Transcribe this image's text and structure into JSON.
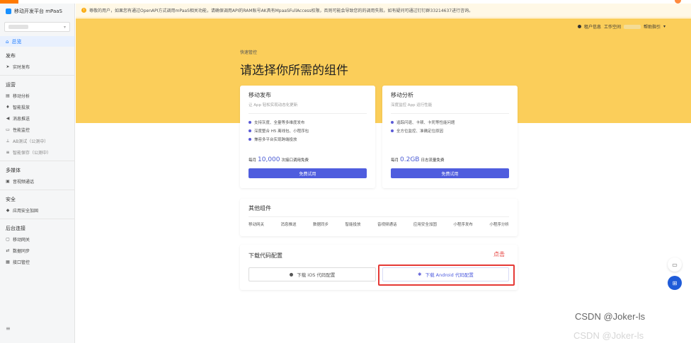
{
  "sidebar": {
    "brand": "移动开发平台 mPaaS",
    "home": "总览",
    "groups": [
      {
        "title": "发布",
        "items": [
          {
            "label": "实时发布",
            "icon": "send-icon"
          }
        ]
      },
      {
        "title": "运营",
        "items": [
          {
            "label": "移动分析",
            "icon": "chart-icon"
          },
          {
            "label": "智能投放",
            "icon": "pin-icon"
          },
          {
            "label": "消息推送",
            "icon": "megaphone-icon"
          },
          {
            "label": "性能监控",
            "icon": "monitor-icon"
          },
          {
            "label": "AB测试（公测中）",
            "icon": "ab-icon"
          },
          {
            "label": "智能保存（公测中）",
            "icon": "save-icon"
          }
        ]
      },
      {
        "title": "多媒体",
        "items": [
          {
            "label": "音视频通话",
            "icon": "video-icon"
          }
        ]
      },
      {
        "title": "安全",
        "items": [
          {
            "label": "应用安全加固",
            "icon": "shield-icon"
          }
        ]
      },
      {
        "title": "后台连接",
        "items": [
          {
            "label": "移动网关",
            "icon": "gateway-icon"
          },
          {
            "label": "数据同步",
            "icon": "sync-icon"
          },
          {
            "label": "接口管控",
            "icon": "api-icon"
          }
        ]
      }
    ]
  },
  "notice": {
    "text": "尊敬的用户，如果您有通过OpenAPI方式调用mPaaS相关功能，请确保调用API的RAM账号AK具有MpaaSFullAccess权限，否则可能会导致您的的调用失败。如有疑问可通过钉钉群33214637进行咨询。"
  },
  "header": {
    "tenant_info": "租户信息",
    "workspace": "工作空间",
    "help": "帮助指引"
  },
  "hero": {
    "breadcrumb": "快速管控",
    "title": "请选择你所需的组件"
  },
  "cards": {
    "publish": {
      "title": "移动发布",
      "subtitle": "让 App 轻松实现动态化更新",
      "features": [
        "支持灰度、全量等多维度发布",
        "深度整合 H5 离线包、小程序包",
        "兼容多平台实现跨端投放"
      ],
      "quota_prefix": "每月",
      "quota_value": "10,000",
      "quota_suffix": "次接口调用免费",
      "button": "免费试用"
    },
    "analytics": {
      "title": "移动分析",
      "subtitle": "深度监控 App 运行性能",
      "features": [
        "追踪闪退、卡顿、卡死等性能问题",
        "全方位监控、准确定位原因"
      ],
      "quota_prefix": "每月",
      "quota_value": "0.2GB",
      "quota_suffix": "日志流量免费",
      "button": "免费试用"
    }
  },
  "other": {
    "title": "其他组件",
    "items": [
      "移动网关",
      "消息推送",
      "数据同步",
      "智能投放",
      "音视频通话",
      "应用安全加固",
      "小程序发布",
      "小程序分析"
    ]
  },
  "download": {
    "title": "下载代码配置",
    "click_hint": "点击",
    "ios_button": "下载 iOS 代码配置",
    "android_button": "下载 Android 代码配置"
  },
  "watermark": "CSDN @Joker-ls",
  "watermark_faded": "CSDN @Joker-ls"
}
